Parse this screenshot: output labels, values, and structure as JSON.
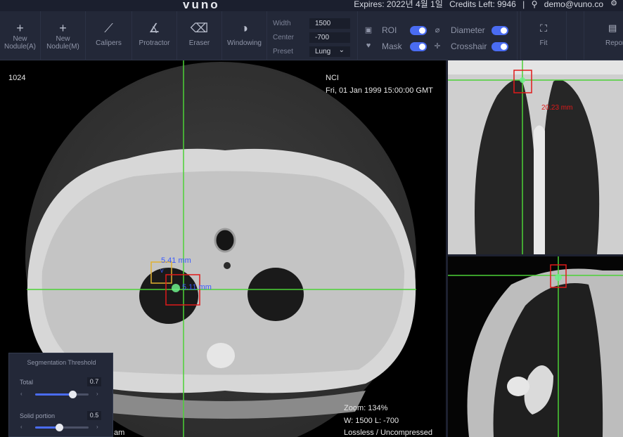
{
  "header": {
    "logo": "vuno",
    "expires": "Expires: 2022년 4월 1일",
    "credits": "Credits Left: 9946",
    "user": "demo@vuno.co"
  },
  "toolbar": {
    "tools": [
      {
        "name": "New",
        "name2": "Nodule(A)",
        "icon": "plus-icon",
        "glyph": "+"
      },
      {
        "name": "New",
        "name2": "Nodule(M)",
        "icon": "plus-icon",
        "glyph": "+"
      },
      {
        "name": "Calipers",
        "icon": "calipers-icon",
        "glyph": "⟋"
      },
      {
        "name": "Protractor",
        "icon": "protractor-icon",
        "glyph": "∡"
      },
      {
        "name": "Eraser",
        "icon": "eraser-icon",
        "glyph": "⌫"
      },
      {
        "name": "Windowing",
        "icon": "windowing-icon",
        "glyph": "◑"
      }
    ],
    "window": {
      "width_label": "Width",
      "width_value": "1500",
      "center_label": "Center",
      "center_value": "-700",
      "preset_label": "Preset",
      "preset_value": "Lung"
    },
    "toggles": [
      {
        "label": "ROI",
        "icon": "roi-icon",
        "on": true
      },
      {
        "label": "Mask",
        "icon": "mask-icon",
        "on": true
      },
      {
        "label": "Diameter",
        "icon": "diameter-icon",
        "on": true
      },
      {
        "label": "Crosshair",
        "icon": "crosshair-icon",
        "on": true
      }
    ],
    "fit_label": "Fit",
    "report_label": "Report"
  },
  "axial": {
    "slice": "1024",
    "institution": "NCI",
    "datetime": "Fri, 01 Jan 1999 15:00:00 GMT",
    "measure_1": "5.41 mm",
    "measure_2": "5.11 mm",
    "zoom": "Zoom: 134%",
    "wl": "W: 1500 L: -700",
    "compression": "Lossless / Uncompressed",
    "partial_bottom": "am"
  },
  "coronal": {
    "measure": "20.23 mm"
  },
  "segmentation": {
    "title": "Segmentation Threshold",
    "total_label": "Total",
    "total_value": "0.7",
    "total_level": 0.7,
    "solid_label": "Solid portion",
    "solid_value": "0.5",
    "solid_level": 0.45
  },
  "colors": {
    "crosshair": "#4cd137",
    "roi_yellow": "#e0b030",
    "roi_red": "#e01a1a",
    "accent": "#4a6cf2",
    "measure_blue": "#3b5bff"
  }
}
